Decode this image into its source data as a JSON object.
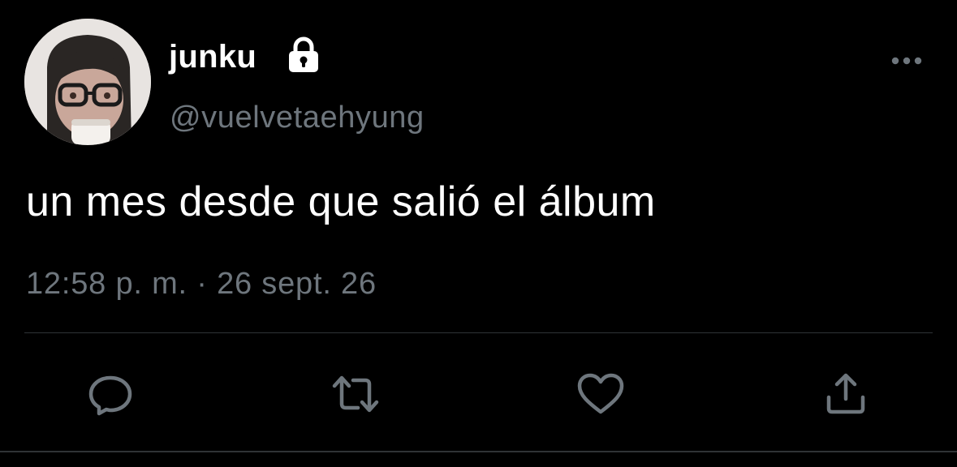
{
  "tweet": {
    "display_name": "junku",
    "username": "@vuelvetaehyung",
    "text": "un mes desde que salió el álbum",
    "timestamp": "12:58 p. m. · 26 sept. 26",
    "protected_icon": "lock-icon",
    "more_icon": "more-horizontal-icon"
  },
  "actions": [
    {
      "name": "reply",
      "icon": "reply-icon"
    },
    {
      "name": "retweet",
      "icon": "retweet-icon"
    },
    {
      "name": "like",
      "icon": "heart-icon"
    },
    {
      "name": "share",
      "icon": "share-icon"
    }
  ],
  "colors": {
    "background": "#000000",
    "primary_text": "#ffffff",
    "secondary_text": "#6e767d",
    "divider": "#2f3336",
    "icon": "#6e767d"
  }
}
